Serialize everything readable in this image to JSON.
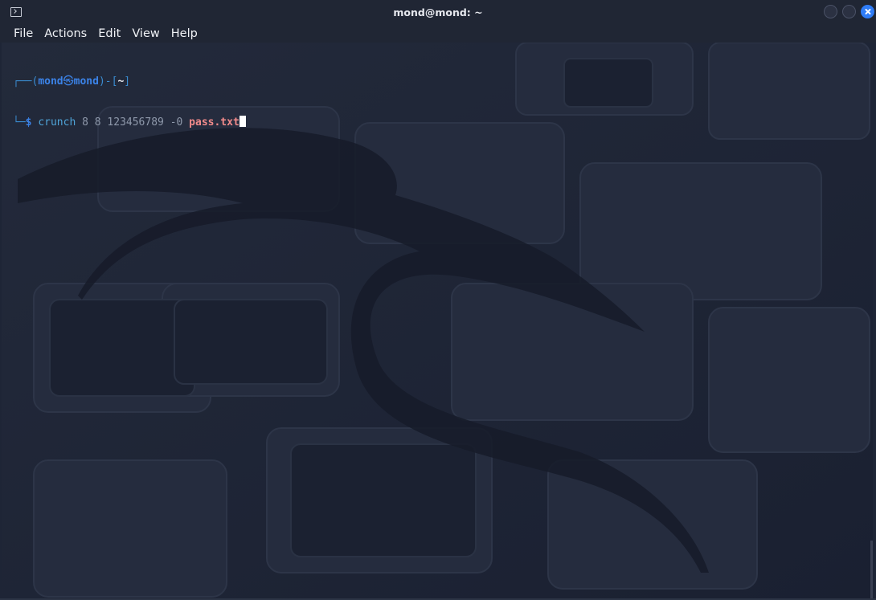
{
  "window": {
    "title": "mond@mond: ~"
  },
  "menu": [
    "File",
    "Actions",
    "Edit",
    "View",
    "Help"
  ],
  "terminal": {
    "prompt_open": "┌──(",
    "user": "mond",
    "at_symbol": "㉿",
    "host": "mond",
    "prompt_mid": ")-[",
    "cwd": "~",
    "prompt_close": "]",
    "line2_prefix": "└─",
    "dollar": "$",
    "command": "crunch",
    "args": "8 8 123456789",
    "flag": "-0",
    "filename": "pass.txt"
  },
  "icons": {
    "app": "terminal-icon",
    "minimize": "minimize-icon",
    "maximize": "maximize-icon",
    "close": "close-icon"
  },
  "colors": {
    "background": "#1e2536",
    "prompt_blue": "#3b83e8",
    "command_cyan": "#4fa4d8",
    "filename_red": "#f28b8b",
    "close_button": "#2f7cf6"
  }
}
